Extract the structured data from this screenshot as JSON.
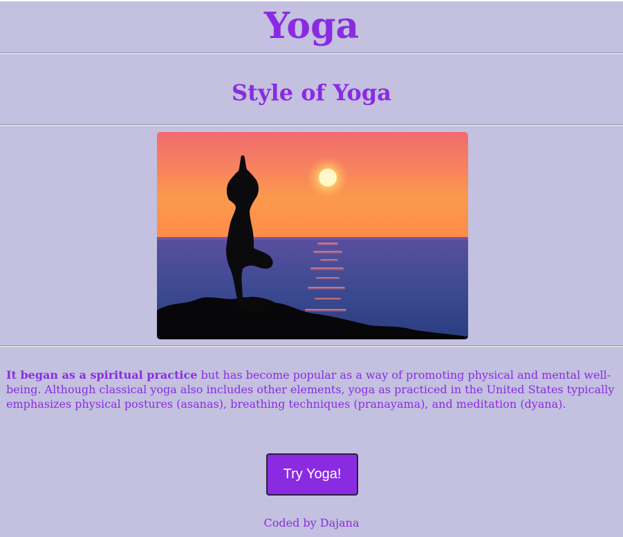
{
  "header": {
    "title": "Yoga",
    "subtitle": "Style of Yoga"
  },
  "hero": {
    "image": "yoga-tree-pose-sunset-silhouette"
  },
  "description": {
    "lead": "It began as a spiritual practice",
    "body": " but has become popular as a way of promoting physical and mental well-being. Although classical yoga also includes other elements, yoga as practiced in the United States typically emphasizes physical postures (asanas), breathing techniques (pranayama), and meditation (dyana)."
  },
  "cta": {
    "label": "Try Yoga!"
  },
  "footer": {
    "credit": "Coded by Dajana"
  },
  "colors": {
    "background": "#c3c0e0",
    "accent": "#8a2be2",
    "button_text": "#ffffff"
  }
}
